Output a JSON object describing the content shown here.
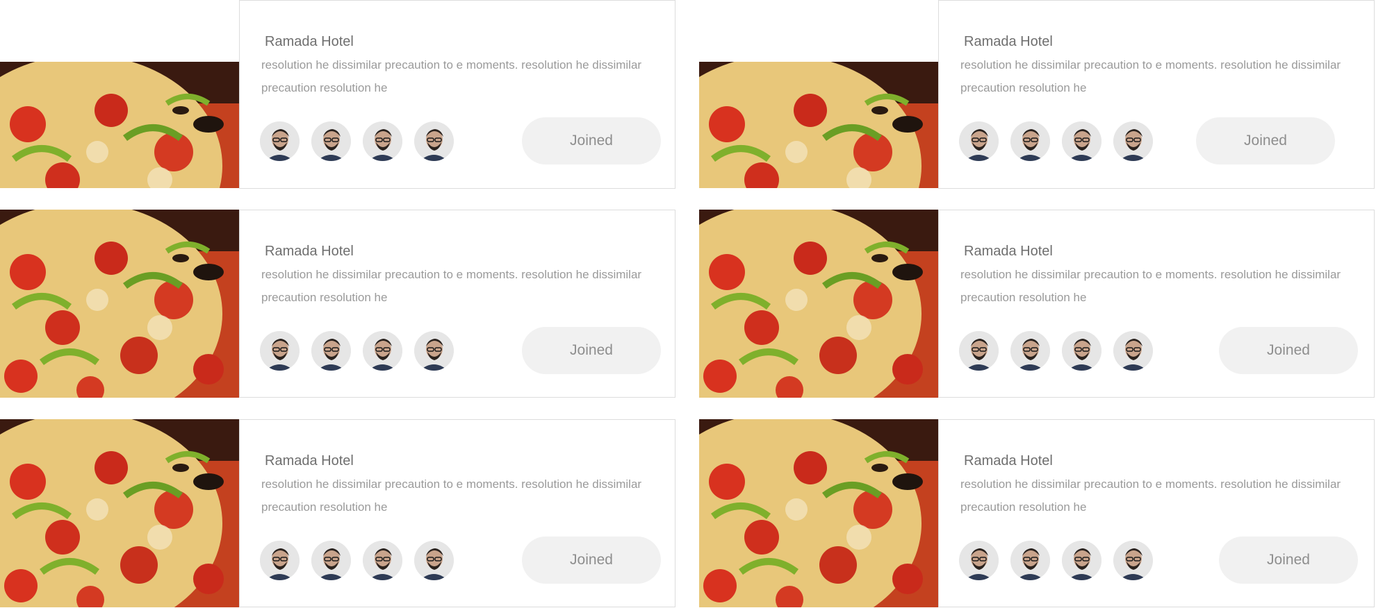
{
  "cards": [
    {
      "title": "Ramada Hotel",
      "description": "resolution he dissimilar precaution to e moments. resolution he dissimilar precaution resolution he",
      "button_label": "Joined"
    },
    {
      "title": "Ramada Hotel",
      "description": "resolution he dissimilar precaution to e moments. resolution he dissimilar precaution resolution he",
      "button_label": "Joined"
    },
    {
      "title": "Ramada Hotel",
      "description": "resolution he dissimilar precaution to e moments. resolution he dissimilar precaution resolution he",
      "button_label": "Joined"
    },
    {
      "title": "Ramada Hotel",
      "description": "resolution he dissimilar precaution to e moments. resolution he dissimilar precaution resolution he",
      "button_label": "Joined"
    },
    {
      "title": "Ramada Hotel",
      "description": "resolution he dissimilar precaution to e moments. resolution he dissimilar precaution resolution he",
      "button_label": "Joined"
    },
    {
      "title": "Ramada Hotel",
      "description": "resolution he dissimilar precaution to e moments. resolution he dissimilar precaution resolution he",
      "button_label": "Joined"
    }
  ],
  "colors": {
    "title": "#6f6f6f",
    "text": "#9a9a9a",
    "button_bg": "#f1f1f1",
    "border": "#dcdcdc"
  },
  "icons": {
    "avatar": "user-avatar",
    "thumbnail": "pizza-image"
  }
}
